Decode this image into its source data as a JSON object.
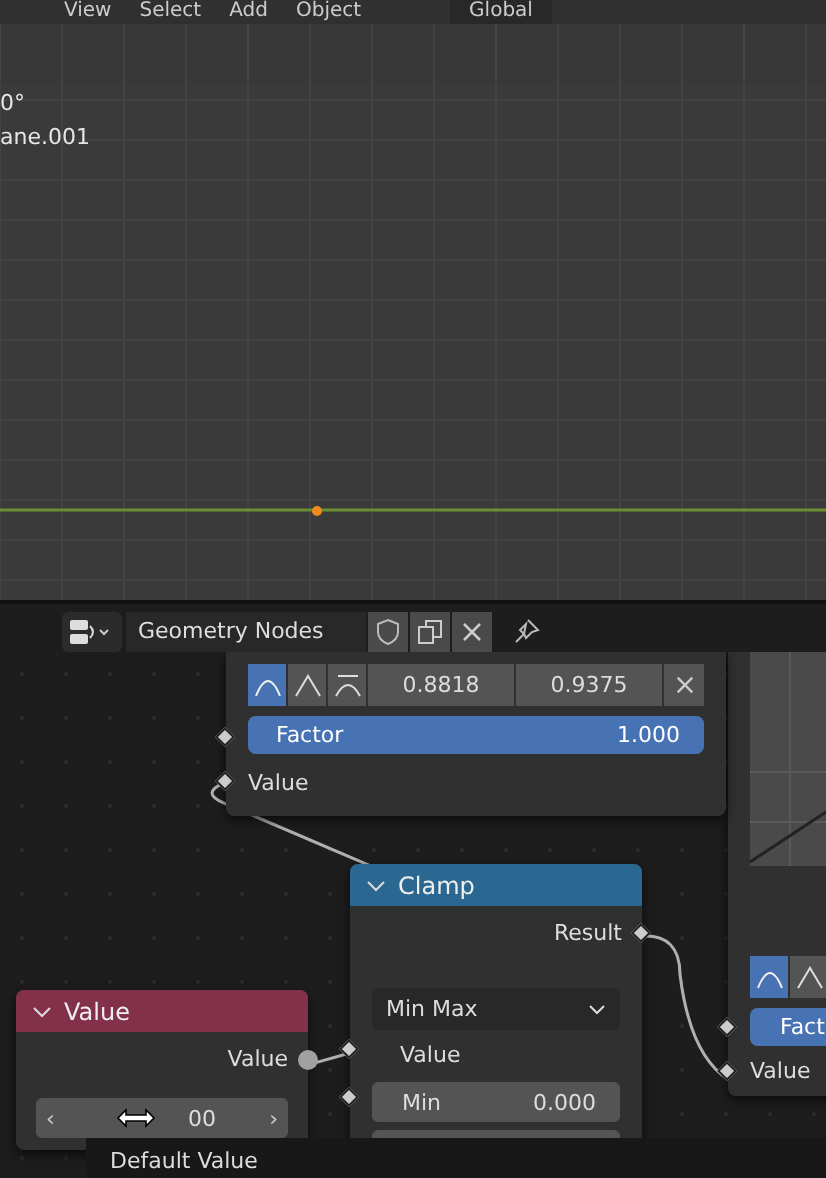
{
  "viewport": {
    "menu": [
      "View",
      "Select",
      "Add",
      "Object"
    ],
    "orientation_dropdown": "Global",
    "overlay_text": [
      "0°",
      "ane.001"
    ]
  },
  "node_editor": {
    "header": {
      "node_tree": "Geometry Nodes"
    },
    "nodes": [
      {
        "kind": "curve",
        "curve_modes": [
          {
            "selected": true
          },
          {
            "selected": false
          },
          {
            "selected": false
          }
        ],
        "fields": [
          "0.8818",
          "0.9375"
        ],
        "factor": {
          "label": "Factor",
          "value": "1.000",
          "level": 1
        },
        "input": "Value"
      },
      {
        "kind": "clamp",
        "title": "Clamp",
        "output": "Result",
        "mode": "Min Max",
        "input": "Value",
        "min": {
          "label": "Min",
          "value": "0.000"
        }
      },
      {
        "kind": "value",
        "title": "Value",
        "output": "Value",
        "field": {
          "left_arrow": "‹",
          "value": "00",
          "right_arrow": "›"
        },
        "tooltip": "Default Value"
      },
      {
        "kind": "partial",
        "curve_modes": [
          {
            "selected": true
          },
          {
            "selected": false
          }
        ],
        "factor": {
          "label": "Fact",
          "level": 1
        },
        "input": "Value"
      }
    ]
  }
}
